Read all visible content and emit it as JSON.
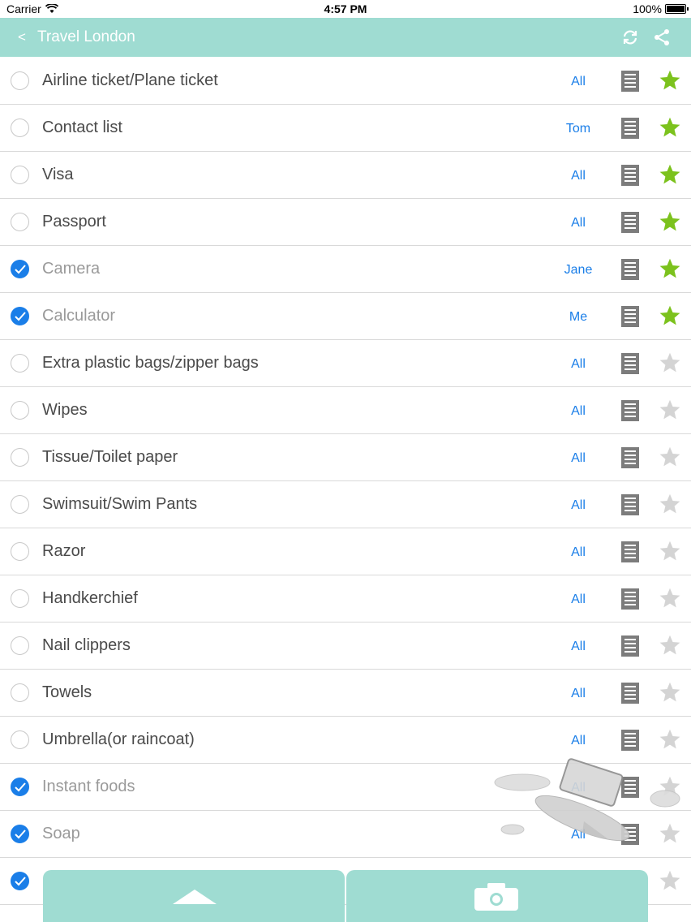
{
  "status_bar": {
    "carrier": "Carrier",
    "time": "4:57 PM",
    "battery": "100%"
  },
  "nav": {
    "back_label": "<",
    "title": "Travel London",
    "sync_icon": "sync-icon",
    "share_icon": "share-icon"
  },
  "colors": {
    "accent": "#9fdcd2",
    "check_blue": "#1a7ee8",
    "star_green": "#7cc21d",
    "star_grey": "#d4d4d4"
  },
  "items": [
    {
      "label": "Airline ticket/Plane ticket",
      "assignee": "All",
      "checked": false,
      "starred": true
    },
    {
      "label": "Contact list",
      "assignee": "Tom",
      "checked": false,
      "starred": true
    },
    {
      "label": "Visa",
      "assignee": "All",
      "checked": false,
      "starred": true
    },
    {
      "label": "Passport",
      "assignee": "All",
      "checked": false,
      "starred": true
    },
    {
      "label": "Camera",
      "assignee": "Jane",
      "checked": true,
      "starred": true
    },
    {
      "label": "Calculator",
      "assignee": "Me",
      "checked": true,
      "starred": true
    },
    {
      "label": "Extra plastic bags/zipper bags",
      "assignee": "All",
      "checked": false,
      "starred": false
    },
    {
      "label": "Wipes",
      "assignee": "All",
      "checked": false,
      "starred": false
    },
    {
      "label": "Tissue/Toilet paper",
      "assignee": "All",
      "checked": false,
      "starred": false
    },
    {
      "label": "Swimsuit/Swim Pants",
      "assignee": "All",
      "checked": false,
      "starred": false
    },
    {
      "label": "Razor",
      "assignee": "All",
      "checked": false,
      "starred": false
    },
    {
      "label": "Handkerchief",
      "assignee": "All",
      "checked": false,
      "starred": false
    },
    {
      "label": "Nail clippers",
      "assignee": "All",
      "checked": false,
      "starred": false
    },
    {
      "label": "Towels",
      "assignee": "All",
      "checked": false,
      "starred": false
    },
    {
      "label": "Umbrella(or raincoat)",
      "assignee": "All",
      "checked": false,
      "starred": false
    },
    {
      "label": "Instant foods",
      "assignee": "All",
      "checked": true,
      "starred": false
    },
    {
      "label": "Soap",
      "assignee": "All",
      "checked": true,
      "starred": false
    },
    {
      "label": "",
      "assignee": "",
      "checked": true,
      "starred": false
    }
  ],
  "bottom": {
    "left_icon": "collapse-up-icon",
    "right_icon": "camera-icon"
  }
}
